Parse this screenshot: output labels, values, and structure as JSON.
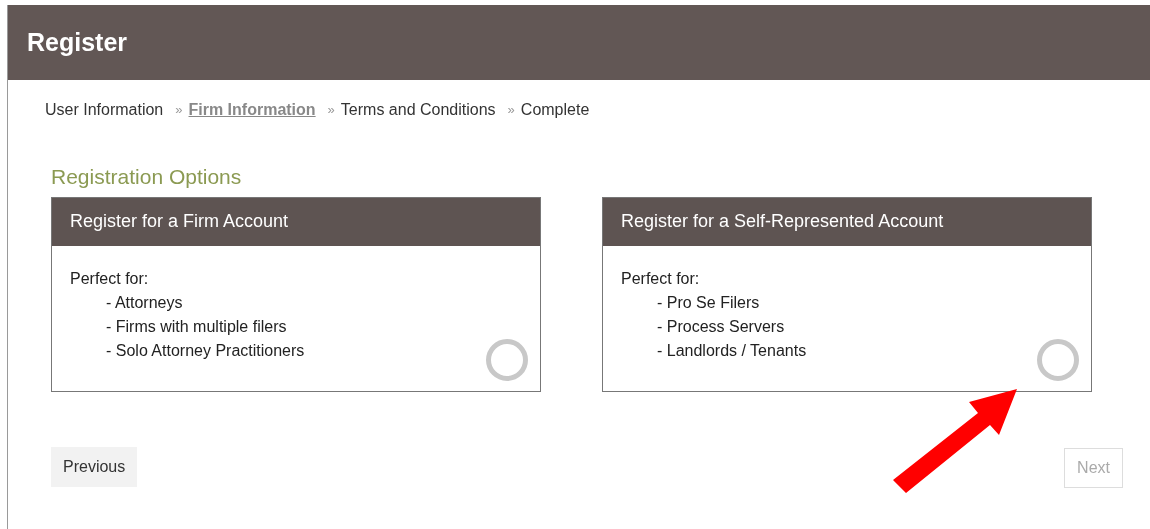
{
  "header": {
    "title": "Register"
  },
  "breadcrumb": [
    {
      "label": "User Information",
      "selected": false
    },
    {
      "separator": "»",
      "label": "Firm Information",
      "selected": true
    },
    {
      "separator": "»",
      "label": "Terms and Conditions",
      "selected": false
    },
    {
      "separator": "»",
      "label": "Complete",
      "selected": false
    }
  ],
  "section_title": "Registration Options",
  "options": [
    {
      "title": "Register for a Firm Account",
      "intro": "Perfect for:",
      "items": [
        "- Attorneys",
        "- Firms with multiple filers",
        "- Solo Attorney Practitioners"
      ],
      "selected": false
    },
    {
      "title": "Register for a Self-Represented Account",
      "intro": "Perfect for:",
      "items": [
        "- Pro Se Filers",
        "- Process Servers",
        "- Landlords / Tenants"
      ],
      "selected": false
    }
  ],
  "buttons": [
    {
      "label": "Previous",
      "disabled": false
    },
    {
      "label": "Next",
      "disabled": true
    }
  ]
}
